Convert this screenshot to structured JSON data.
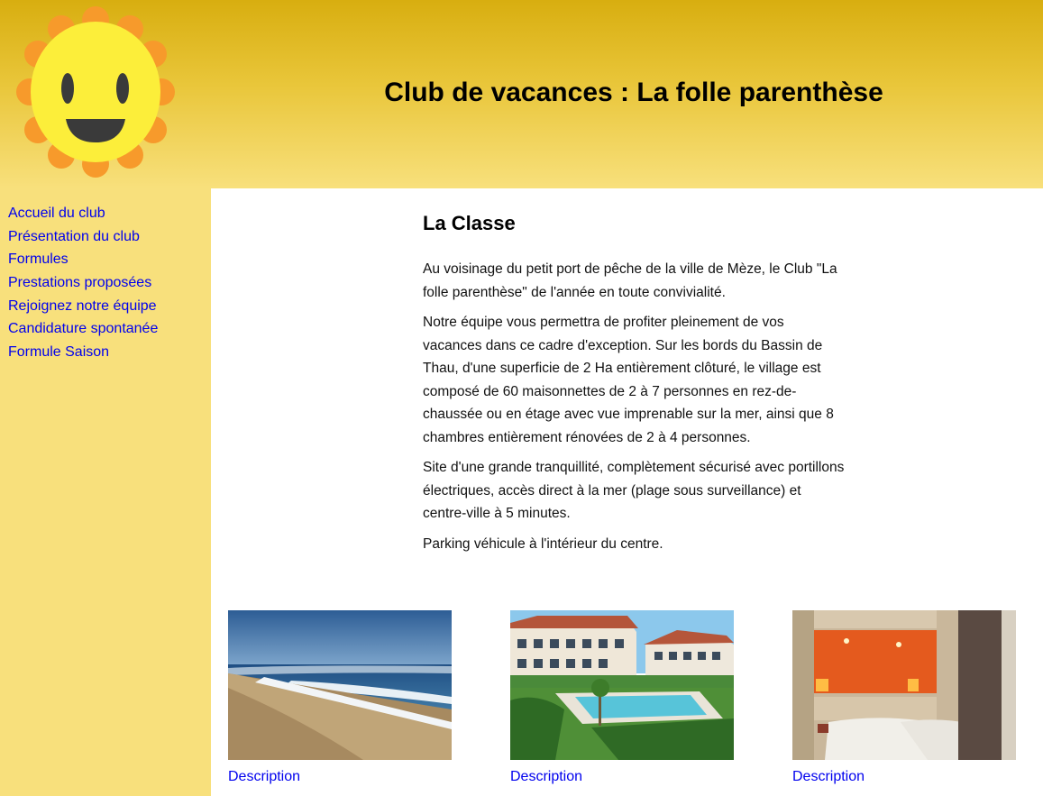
{
  "header": {
    "title": "Club de vacances : La folle parenthèse",
    "logo_icon": "smiling-sun-icon"
  },
  "sidebar": {
    "items": [
      {
        "label": "Accueil du club"
      },
      {
        "label": "Présentation du club"
      },
      {
        "label": "Formules"
      },
      {
        "label": "Prestations proposées"
      },
      {
        "label": "Rejoignez notre équipe"
      },
      {
        "label": "Candidature spontanée"
      },
      {
        "label": "Formule Saison"
      }
    ]
  },
  "article": {
    "heading": "La Classe",
    "paragraphs": [
      "Au voisinage du petit port de pêche de la ville de Mèze, le Club \"La folle parenthèse\" de l'année en toute convivialité.",
      "Notre équipe vous permettra de profiter pleinement de vos vacances dans ce cadre d'exception. Sur les bords du Bassin de Thau, d'une superficie de 2 Ha entièrement clôturé, le village est composé de 60 maisonnettes de 2 à 7 personnes en rez-de-chaussée ou en étage avec vue imprenable sur la mer, ainsi que 8 chambres entièrement rénovées de 2 à 4 personnes.",
      "Site d'une grande tranquillité, complètement sécurisé avec portillons électriques, accès direct à la mer (plage sous surveillance) et centre-ville à 5 minutes.",
      "Parking véhicule à l'intérieur du centre."
    ]
  },
  "gallery": [
    {
      "caption": "Description",
      "image": "beach-photo"
    },
    {
      "caption": "Description",
      "image": "hotel-pool-photo"
    },
    {
      "caption": "Description",
      "image": "bedroom-photo"
    }
  ],
  "colors": {
    "header_top": "#d8ae10",
    "sidebar_bg": "#f8e07c",
    "link": "#0000ee",
    "content_bg": "#ffffff"
  }
}
